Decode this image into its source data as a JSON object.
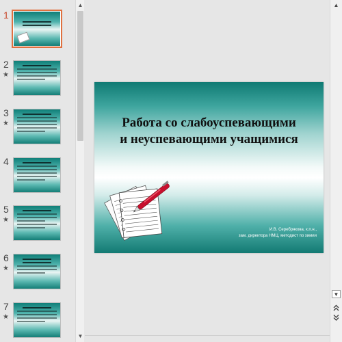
{
  "thumbnails": [
    {
      "number": "1",
      "selected": true,
      "has_animation": false
    },
    {
      "number": "2",
      "selected": false,
      "has_animation": true
    },
    {
      "number": "3",
      "selected": false,
      "has_animation": true
    },
    {
      "number": "4",
      "selected": false,
      "has_animation": false
    },
    {
      "number": "5",
      "selected": false,
      "has_animation": true
    },
    {
      "number": "6",
      "selected": false,
      "has_animation": true
    },
    {
      "number": "7",
      "selected": false,
      "has_animation": true
    }
  ],
  "animation_marker": "★",
  "slide": {
    "title_line1": "Работа со слабоуспевающими",
    "title_line2": "и неуспевающими учащимися",
    "author_line1": "И.В. Серебрякова, к.п.н.,",
    "author_line2": "зам. директора НМЦ, методист по химии"
  },
  "scrollbar": {
    "up_icon": "triangle-up",
    "down_icon": "triangle-down",
    "prev_slide_icon": "double-chevron-up",
    "next_slide_icon": "double-chevron-down"
  },
  "colors": {
    "slide_teal": "#0f7a73",
    "selection_orange": "#e0703f",
    "active_number": "#c8472b",
    "pen_red": "#c8102e"
  }
}
